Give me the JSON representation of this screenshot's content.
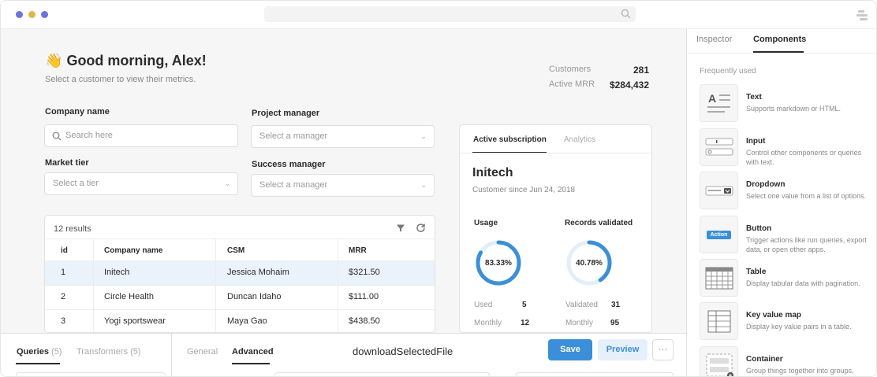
{
  "window": {
    "dots": [
      "#6f72d6",
      "#e2b44a",
      "#6f72d6"
    ]
  },
  "dashboard": {
    "greeting_emoji": "👋",
    "greeting": "Good morning, Alex!",
    "subtitle": "Select a customer to view their metrics.",
    "stats": [
      {
        "label": "Customers",
        "value": "281"
      },
      {
        "label": "Active MRR",
        "value": "$284,432"
      }
    ],
    "filters": {
      "company_label": "Company name",
      "company_placeholder": "Search here",
      "project_label": "Project manager",
      "project_placeholder": "Select a manager",
      "tier_label": "Market tier",
      "tier_placeholder": "Select a tier",
      "success_label": "Success manager",
      "success_placeholder": "Select a manager"
    },
    "table": {
      "results": "12 results",
      "columns": [
        "id",
        "Company name",
        "CSM",
        "MRR"
      ],
      "rows": [
        {
          "id": "1",
          "company": "Initech",
          "csm": "Jessica Mohaim",
          "mrr": "$321.50",
          "selected": true
        },
        {
          "id": "2",
          "company": "Circle Health",
          "csm": "Duncan Idaho",
          "mrr": "$111.00",
          "selected": false
        },
        {
          "id": "3",
          "company": "Yogi sportswear",
          "csm": "Maya Gao",
          "mrr": "$438.50",
          "selected": false
        }
      ]
    },
    "subscription": {
      "tab_active": "Active subscription",
      "tab_other": "Analytics",
      "company": "Initech",
      "since": "Customer since Jun 24, 2018",
      "usage": {
        "title": "Usage",
        "percent_label": "83.33%",
        "fraction": 0.8333,
        "row1_label": "Used",
        "row1_value": "5",
        "row2_label": "Monthly",
        "row2_value": "12"
      },
      "records": {
        "title": "Records validated",
        "percent_label": "40.78%",
        "fraction": 0.4078,
        "row1_label": "Validated",
        "row1_value": "31",
        "row2_label": "Monthly",
        "row2_value": "95"
      },
      "ring_color": "#3b8fd9"
    }
  },
  "bottom": {
    "queries_label": "Queries",
    "queries_count": "(5)",
    "transformers_label": "Transformers",
    "transformers_count": "(5)",
    "tab_general": "General",
    "tab_advanced": "Advanced",
    "function_name": "downloadSelectedFile",
    "save": "Save",
    "preview": "Preview",
    "more": "···"
  },
  "panel": {
    "tab_inspector": "Inspector",
    "tab_components": "Components",
    "section": "Frequently used",
    "components": [
      {
        "title": "Text",
        "desc": "Supports markdown or HTML.",
        "icon": "text-component-icon"
      },
      {
        "title": "Input",
        "desc": "Control other components or queries with text.",
        "icon": "input-component-icon"
      },
      {
        "title": "Dropdown",
        "desc": "Select one value from a list of options.",
        "icon": "dropdown-component-icon"
      },
      {
        "title": "Button",
        "desc": "Trigger actions like run queries, export data, or open other apps.",
        "icon": "button-component-icon",
        "icon_text": "Action"
      },
      {
        "title": "Table",
        "desc": "Display tabular data with pagination.",
        "icon": "table-component-icon"
      },
      {
        "title": "Key value map",
        "desc": "Display key value pairs in a table.",
        "icon": "key-value-component-icon"
      },
      {
        "title": "Container",
        "desc": "Group things together into groups, also nestable.",
        "icon": "container-component-icon"
      }
    ]
  }
}
